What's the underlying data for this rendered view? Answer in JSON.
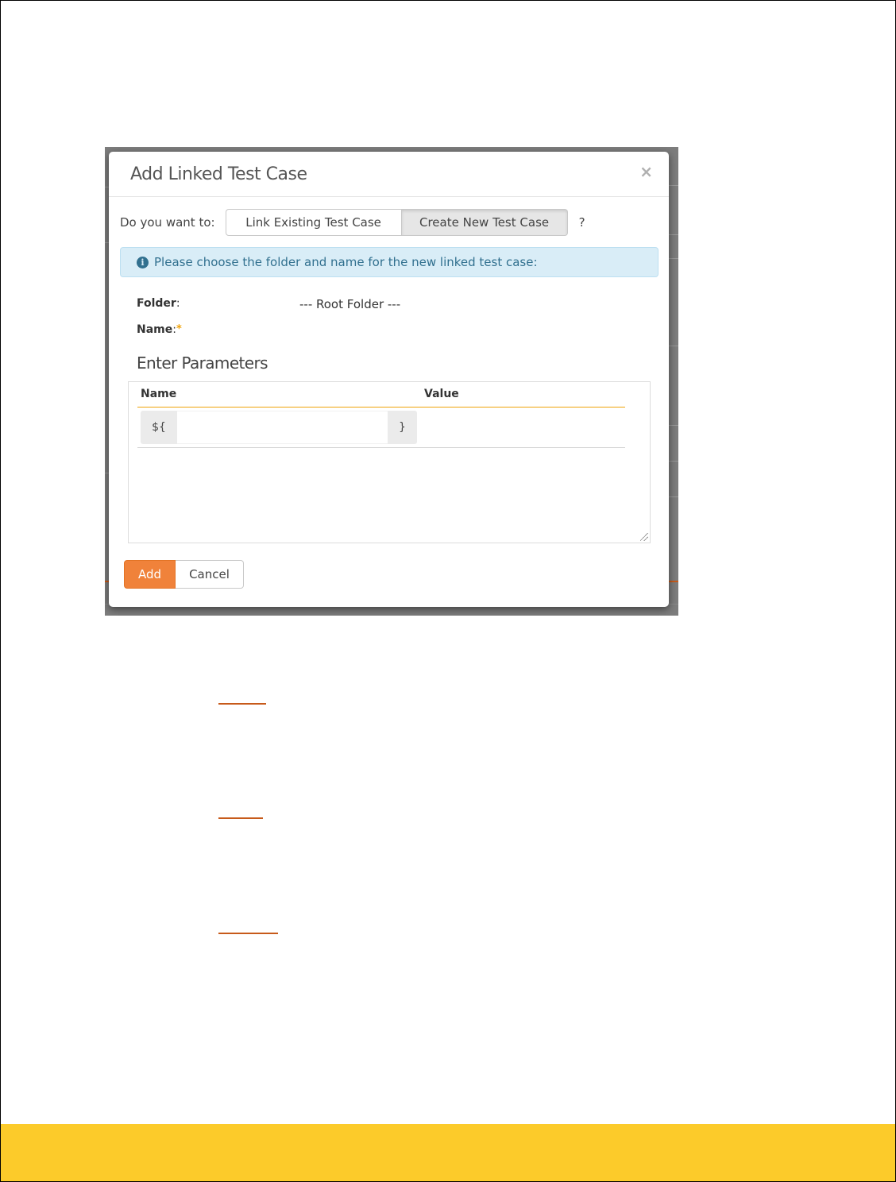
{
  "modal": {
    "title": "Add Linked Test Case",
    "close_glyph": "×",
    "choice_label": "Do you want to:",
    "option_link_existing": "Link Existing Test Case",
    "option_create_new": "Create New Test Case",
    "selected_option": "Create New Test Case",
    "help_mark": "?",
    "info_message": "Please choose the folder and name for the new linked test case:",
    "info_icon": "info-circle-icon",
    "folder_label": "Folder",
    "folder_value": "--- Root Folder ---",
    "name_label": "Name",
    "required_mark": "*",
    "parameters_heading": "Enter Parameters",
    "parameters_table": {
      "columns": [
        "Name",
        "Value"
      ],
      "rows": [
        {
          "prefix": "${",
          "name": "",
          "suffix": "}",
          "value": ""
        }
      ]
    },
    "add_button": "Add",
    "cancel_button": "Cancel"
  },
  "colors": {
    "accent_orange": "#f0823a",
    "footer_yellow": "#fccb2a",
    "info_background": "#d9edf7",
    "info_text": "#31708f",
    "required_star": "#f0a30a"
  }
}
